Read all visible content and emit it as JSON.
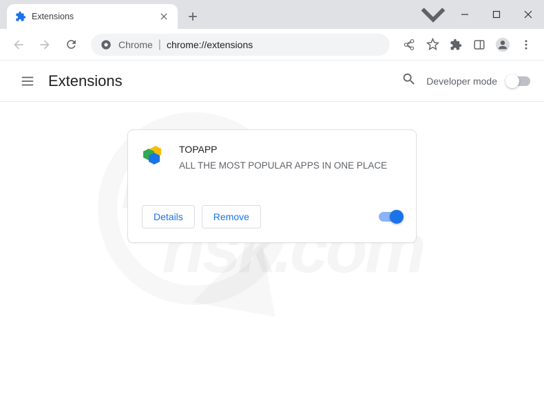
{
  "window": {
    "tab_title": "Extensions"
  },
  "omnibox": {
    "prefix": "Chrome",
    "url": "chrome://extensions"
  },
  "ext_page": {
    "title": "Extensions",
    "dev_mode_label": "Developer mode",
    "dev_mode_on": false
  },
  "extension": {
    "name": "TOPAPP",
    "description": "ALL THE MOST POPULAR APPS IN ONE PLACE",
    "details_label": "Details",
    "remove_label": "Remove",
    "enabled": true
  },
  "watermark": {
    "line1": "PC",
    "line2": "risk.com"
  }
}
